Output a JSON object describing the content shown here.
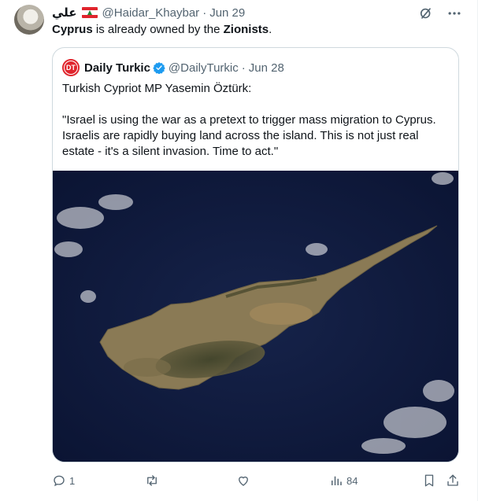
{
  "tweet": {
    "display_name": "علي",
    "handle": "@Haidar_Khaybar",
    "separator": "·",
    "date": "Jun 29",
    "text_parts": [
      "Cyprus",
      " is already owned by the ",
      "Zionists",
      "."
    ]
  },
  "quote": {
    "avatar_text": "DT",
    "name": "Daily Turkic",
    "handle": "@DailyTurkic",
    "separator": "·",
    "date": "Jun 28",
    "paragraph1": "Turkish Cypriot MP Yasemin Öztürk:",
    "paragraph2_lines": [
      "\"Israel is using the war as a pretext to trigger mass migration to Cyprus.",
      "Israelis are rapidly buying land across the island. This is not just real",
      "estate - it's a silent invasion. Time to act.\""
    ]
  },
  "actions": {
    "reply_count": "1",
    "repost_count": "",
    "like_count": "",
    "views_count": "84"
  },
  "colors": {
    "text": "#0f1419",
    "secondary": "#536471",
    "border": "#cfd9de",
    "verified": "#1d9bf0",
    "flag_red": "#e0252d"
  },
  "icons": [
    "grok-icon",
    "more-icon",
    "verified-badge-icon",
    "reply-icon",
    "repost-icon",
    "like-icon",
    "views-icon",
    "bookmark-icon",
    "share-icon"
  ]
}
